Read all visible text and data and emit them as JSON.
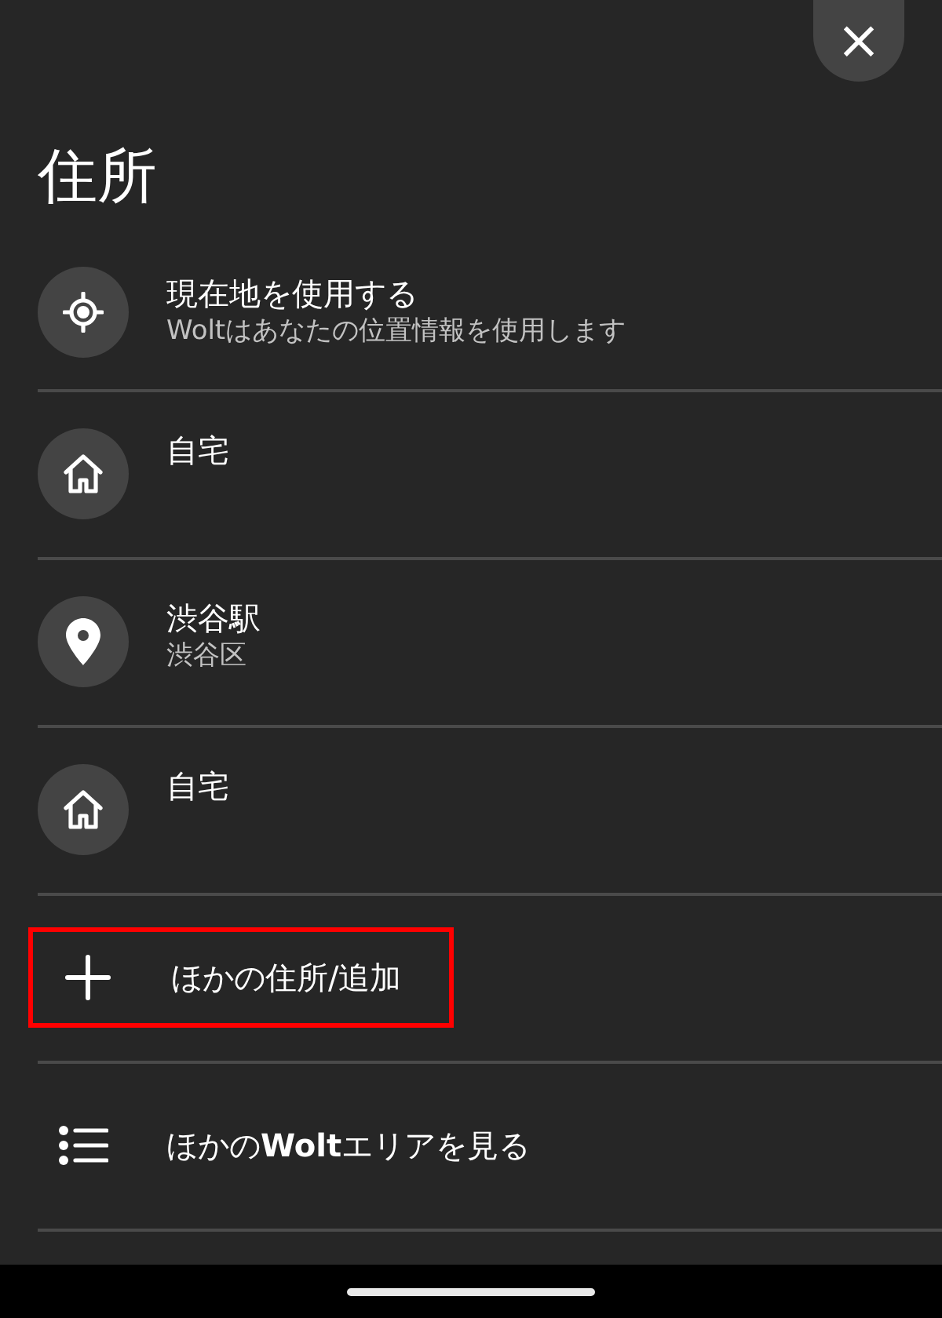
{
  "close_button": {
    "label": "×"
  },
  "title": "住所",
  "items": [
    {
      "kind": "current-location",
      "title": "現在地を使用する",
      "subtitle": "Woltはあなたの位置情報を使用します",
      "highlighted": false
    },
    {
      "kind": "home",
      "title": "自宅",
      "highlighted": false
    },
    {
      "kind": "place",
      "title": "渋谷駅",
      "subtitle": "渋谷区",
      "highlighted": false
    },
    {
      "kind": "home",
      "title": "自宅",
      "highlighted": false
    },
    {
      "kind": "add",
      "title": "ほかの住所/追加",
      "highlighted": true
    },
    {
      "kind": "browse",
      "title": "ほかの**Wolt**エリアを見る",
      "highlighted": false
    }
  ]
}
